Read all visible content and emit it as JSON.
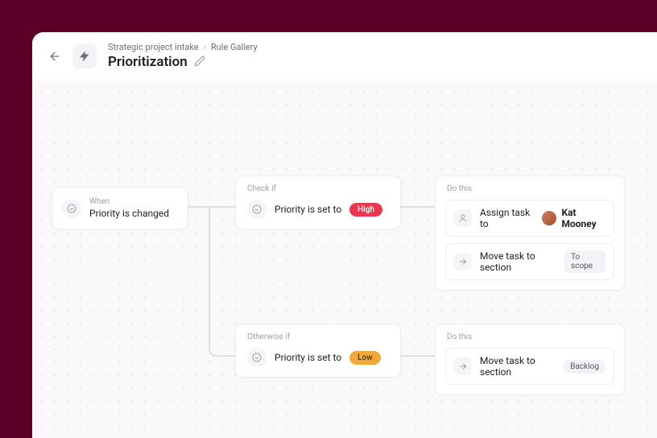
{
  "header": {
    "breadcrumb": {
      "project": "Strategic project intake",
      "section": "Rule Gallery"
    },
    "title": "Prioritization"
  },
  "trigger": {
    "label": "When",
    "text": "Priority is changed"
  },
  "branches": [
    {
      "condition": {
        "label": "Check if",
        "text": "Priority is set to",
        "value": "High",
        "pill_class": "pill-high"
      },
      "actions": {
        "label": "Do this",
        "items": [
          {
            "type": "assign",
            "text": "Assign task to",
            "assignee": "Kat Mooney"
          },
          {
            "type": "move",
            "text": "Move task to section",
            "section": "To scope"
          }
        ]
      }
    },
    {
      "condition": {
        "label": "Otherwise if",
        "text": "Priority is set to",
        "value": "Low",
        "pill_class": "pill-low"
      },
      "actions": {
        "label": "Do this",
        "items": [
          {
            "type": "move",
            "text": "Move task to section",
            "section": "Backlog"
          }
        ]
      }
    }
  ]
}
